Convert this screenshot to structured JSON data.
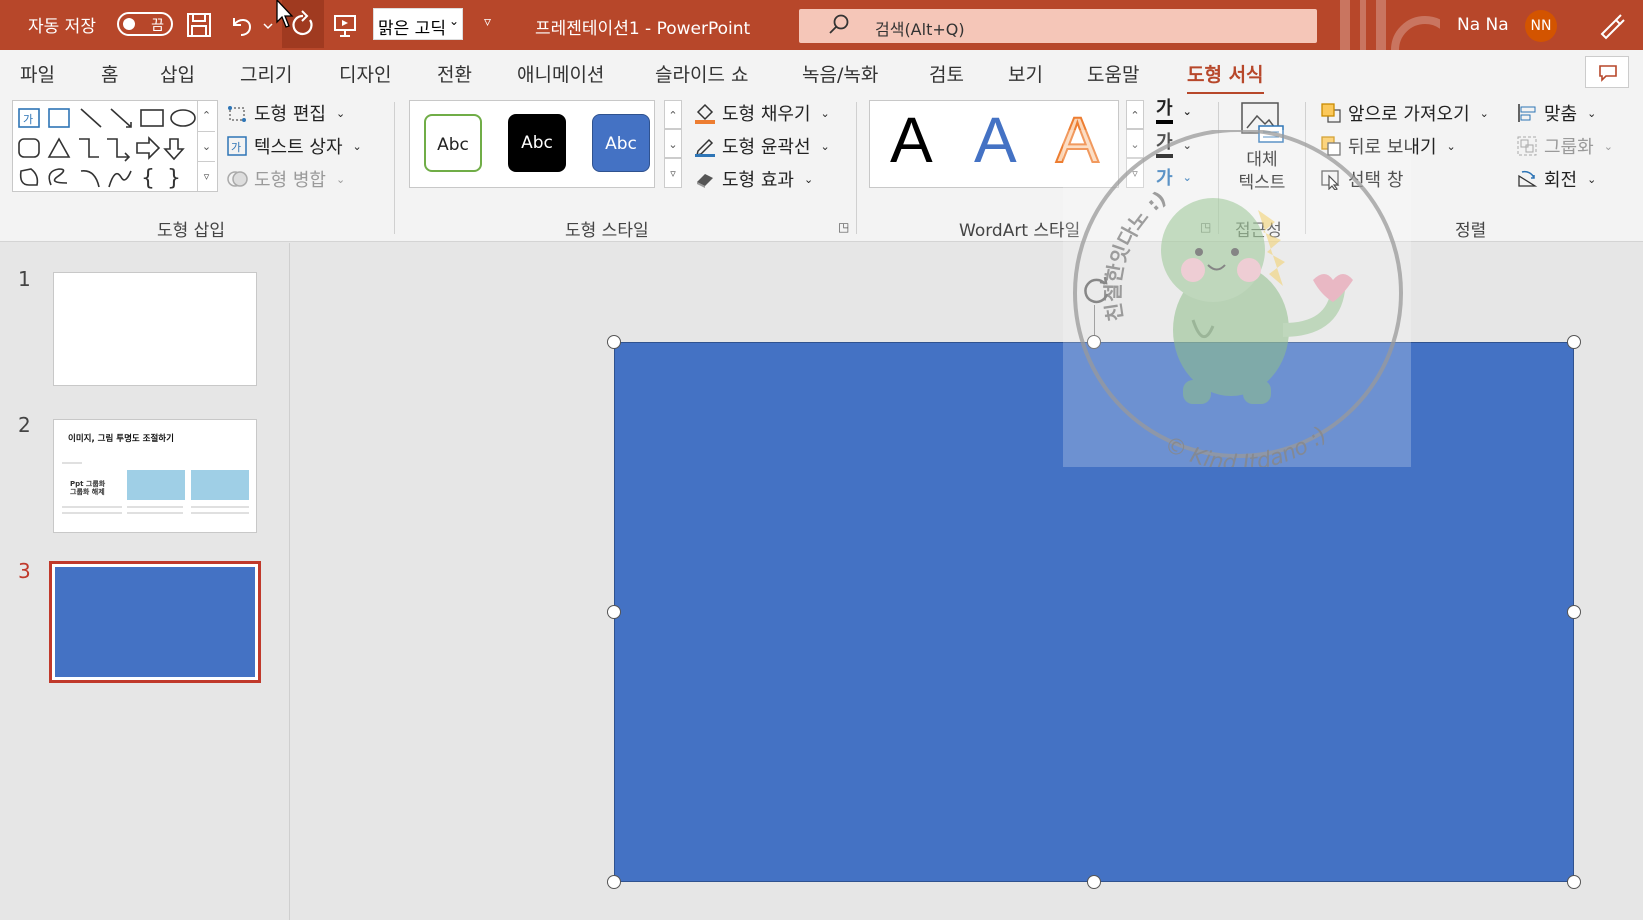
{
  "titlebar": {
    "autosave_label": "자동 저장",
    "autosave_state": "끔",
    "font_name": "맑은 고딕",
    "doc_title": "프레젠테이션1  -  PowerPoint",
    "search_placeholder": "검색(Alt+Q)",
    "user_name": "Na Na",
    "user_initials": "NN",
    "accent_color": "#b7472a"
  },
  "tabs": [
    {
      "label": "파일"
    },
    {
      "label": "홈"
    },
    {
      "label": "삽입"
    },
    {
      "label": "그리기"
    },
    {
      "label": "디자인"
    },
    {
      "label": "전환"
    },
    {
      "label": "애니메이션"
    },
    {
      "label": "슬라이드 쇼"
    },
    {
      "label": "녹음/녹화"
    },
    {
      "label": "검토"
    },
    {
      "label": "보기"
    },
    {
      "label": "도움말"
    },
    {
      "label": "도형 서식",
      "active": true
    }
  ],
  "ribbon": {
    "insert_shapes": {
      "edit_shape": "도형 편집",
      "text_box": "텍스트 상자",
      "merge_shapes": "도형 병합",
      "label": "도형 삽입"
    },
    "shape_styles": {
      "preset_text": "Abc",
      "fill": "도형 채우기",
      "outline": "도형 윤곽선",
      "effects": "도형 효과",
      "label": "도형 스타일"
    },
    "wordart": {
      "letter": "A",
      "text_glyph": "가",
      "label": "WordArt 스타일"
    },
    "accessibility": {
      "alt_text_line1": "대체",
      "alt_text_line2": "텍스트",
      "label": "접근성"
    },
    "arrange": {
      "bring_forward": "앞으로 가져오기",
      "send_backward": "뒤로 보내기",
      "selection_pane": "선택 창",
      "align": "맞춤",
      "group": "그룹화",
      "rotate": "회전",
      "label": "정렬"
    }
  },
  "slides": [
    {
      "number": "1"
    },
    {
      "number": "2",
      "title": "이미지, 그림 투명도 조절하기",
      "caption1": "Ppt 그룹화",
      "caption2": "그룹화 해제"
    },
    {
      "number": "3",
      "selected": true
    }
  ],
  "canvas": {
    "shape_color": "#4472c4"
  },
  "watermark": {
    "text_top": "친절한잇다노 :)",
    "text_bottom": "© Kind Itdano :)"
  }
}
